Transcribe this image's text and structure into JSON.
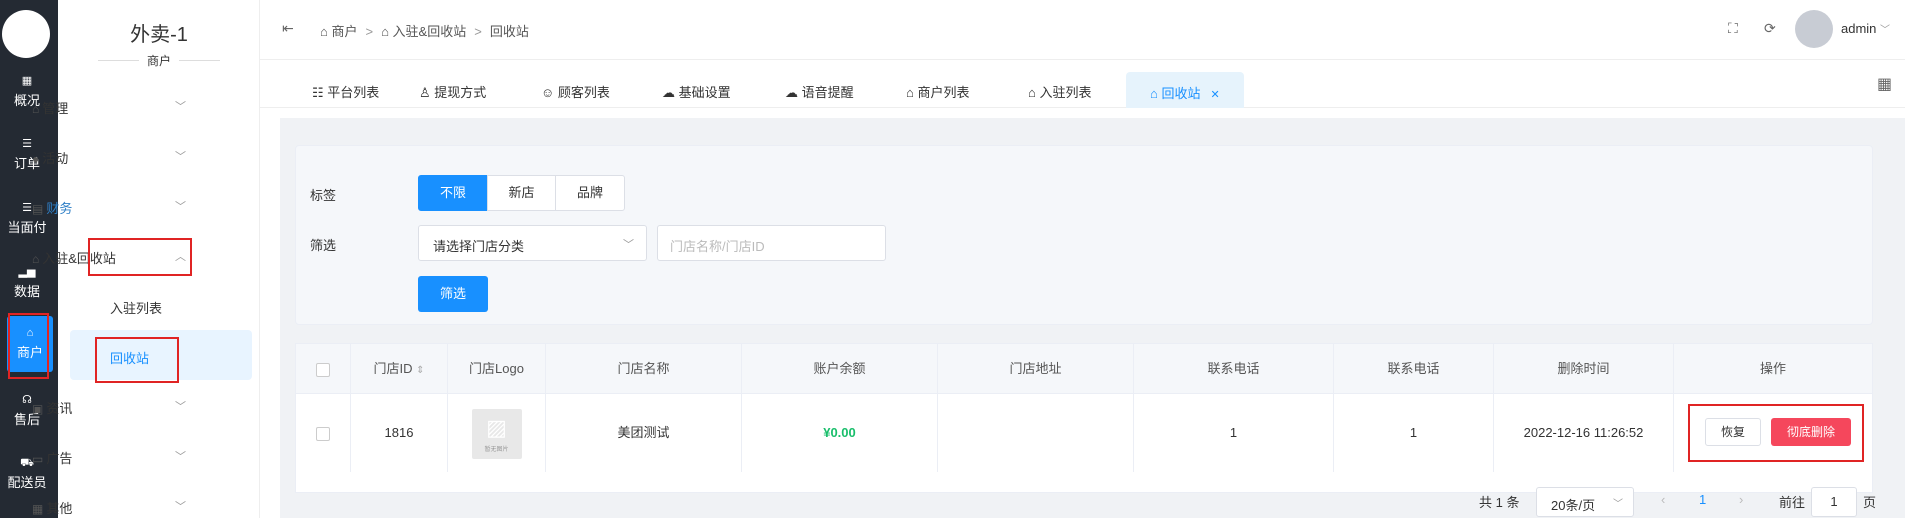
{
  "rail": {
    "items": [
      {
        "icon": "grid-icon",
        "glyph": "▦",
        "label": "概况"
      },
      {
        "icon": "list-icon",
        "glyph": "☰",
        "label": "订单"
      },
      {
        "icon": "list-icon",
        "glyph": "☰",
        "label": "当面付"
      },
      {
        "icon": "bar-chart-icon",
        "glyph": "▂▅",
        "label": "数据"
      },
      {
        "icon": "store-icon",
        "glyph": "⌂",
        "label": "商户"
      },
      {
        "icon": "headset-icon",
        "glyph": "☊",
        "label": "售后"
      },
      {
        "icon": "scooter-icon",
        "glyph": "⛟",
        "label": "配送员"
      }
    ],
    "active_index": 4
  },
  "sidebar": {
    "title": "外卖-1",
    "subtitle": "商户",
    "items": [
      {
        "icon": "store-icon",
        "label": "管理"
      },
      {
        "icon": "user-circle-icon",
        "label": "活动"
      },
      {
        "icon": "finance-icon",
        "label": "财务"
      },
      {
        "icon": "store-icon",
        "label": "入驻&回收站"
      },
      {
        "icon": "info-icon",
        "label": "资讯"
      },
      {
        "icon": "monitor-icon",
        "label": "广告"
      },
      {
        "icon": "grid-icon",
        "label": "其他"
      }
    ],
    "subitems": [
      "入驻列表",
      "回收站"
    ],
    "active_subitem": "回收站"
  },
  "header": {
    "breadcrumb": [
      "商户",
      "入驻&回收站",
      "回收站"
    ],
    "user": "admin"
  },
  "tabs": [
    {
      "icon": "list-icon",
      "label": "平台列表"
    },
    {
      "icon": "user-icon",
      "label": "提现方式"
    },
    {
      "icon": "user-circle-icon",
      "label": "顾客列表"
    },
    {
      "icon": "wechat-icon",
      "label": "基础设置"
    },
    {
      "icon": "wechat-icon",
      "label": "语音提醒"
    },
    {
      "icon": "store-icon",
      "label": "商户列表"
    },
    {
      "icon": "store-icon",
      "label": "入驻列表"
    },
    {
      "icon": "store-icon",
      "label": "回收站",
      "active": true
    }
  ],
  "filter": {
    "tag_label": "标签",
    "tags": [
      "不限",
      "新店",
      "品牌"
    ],
    "active_tag": "不限",
    "filter_label": "筛选",
    "category_placeholder": "请选择门店分类",
    "search_placeholder": "门店名称/门店ID",
    "filter_button": "筛选"
  },
  "table": {
    "headers": [
      "门店ID",
      "门店Logo",
      "门店名称",
      "账户余额",
      "门店地址",
      "联系电话",
      "联系电话",
      "删除时间",
      "操作"
    ],
    "rows": [
      {
        "id": "1816",
        "logo_text": "暂无图片",
        "name": "美团测试",
        "balance": "¥0.00",
        "address": "",
        "phone1": "1",
        "phone2": "1",
        "deleted_at": "2022-12-16 11:26:52",
        "restore": "恢复",
        "delete": "彻底删除"
      }
    ]
  },
  "pagination": {
    "total": "共 1 条",
    "page_size": "20条/页",
    "current_page": "1",
    "goto_label": "前往",
    "goto_value": "1",
    "page_suffix": "页"
  },
  "colors": {
    "primary": "#1890ff",
    "danger": "#f5475c",
    "money": "#19be6b",
    "rail": "#242a33"
  }
}
